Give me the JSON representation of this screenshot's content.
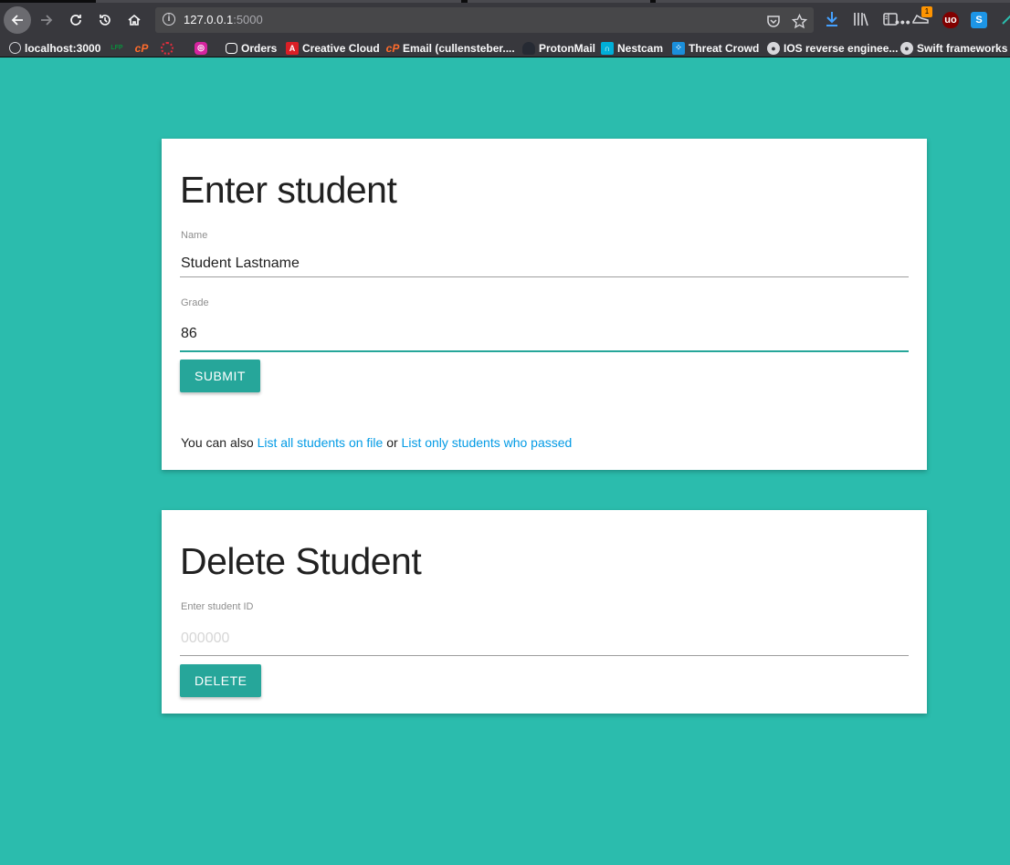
{
  "browser": {
    "url_host": "127.0.0.1",
    "url_port": ":5000",
    "page_actions": "•••",
    "addon_badge": "1",
    "bookmarks": [
      {
        "label": "localhost:3000",
        "icon": "globe-icon",
        "color": "#d7d7db"
      },
      {
        "label": "",
        "icon": "lfp-icon",
        "color": "#0a8f3d"
      },
      {
        "label": "",
        "icon": "cpanel-icon",
        "color": "#ff6c2c"
      },
      {
        "label": "",
        "icon": "dotted-circle-icon",
        "color": "#e22d3c"
      },
      {
        "label": "",
        "icon": "instagram-icon",
        "color": "#d6249f"
      },
      {
        "label": "Orders",
        "icon": "chat-bubble-icon",
        "color": "#ffffff"
      },
      {
        "label": "Creative Cloud",
        "icon": "adobe-icon",
        "color": "#da1f26"
      },
      {
        "label": "Email (cullensteber....",
        "icon": "cpanel-icon",
        "color": "#ff6c2c"
      },
      {
        "label": "ProtonMail",
        "icon": "protonmail-icon",
        "color": "#262a33"
      },
      {
        "label": "Nestcam",
        "icon": "nest-icon",
        "color": "#00afd8"
      },
      {
        "label": "Threat Crowd",
        "icon": "threatcrowd-icon",
        "color": "#1b8fdb"
      },
      {
        "label": "IOS reverse enginee...",
        "icon": "github-icon",
        "color": "#d7d7db"
      },
      {
        "label": "Swift frameworks",
        "icon": "github-icon",
        "color": "#d7d7db"
      }
    ]
  },
  "enter_form": {
    "title": "Enter student",
    "name_label": "Name",
    "name_value": "Student Lastname",
    "grade_label": "Grade",
    "grade_value": "86",
    "submit_label": "SUBMIT",
    "footer_prefix": "You can also ",
    "link_all": "List all students on file",
    "footer_or": " or ",
    "link_passed": "List only students who passed"
  },
  "delete_form": {
    "title": "Delete Student",
    "id_label": "Enter student ID",
    "id_placeholder": "000000",
    "delete_label": "DELETE"
  },
  "colors": {
    "page_background": "#2bbcad",
    "button": "#26a69a",
    "link": "#039be5"
  }
}
